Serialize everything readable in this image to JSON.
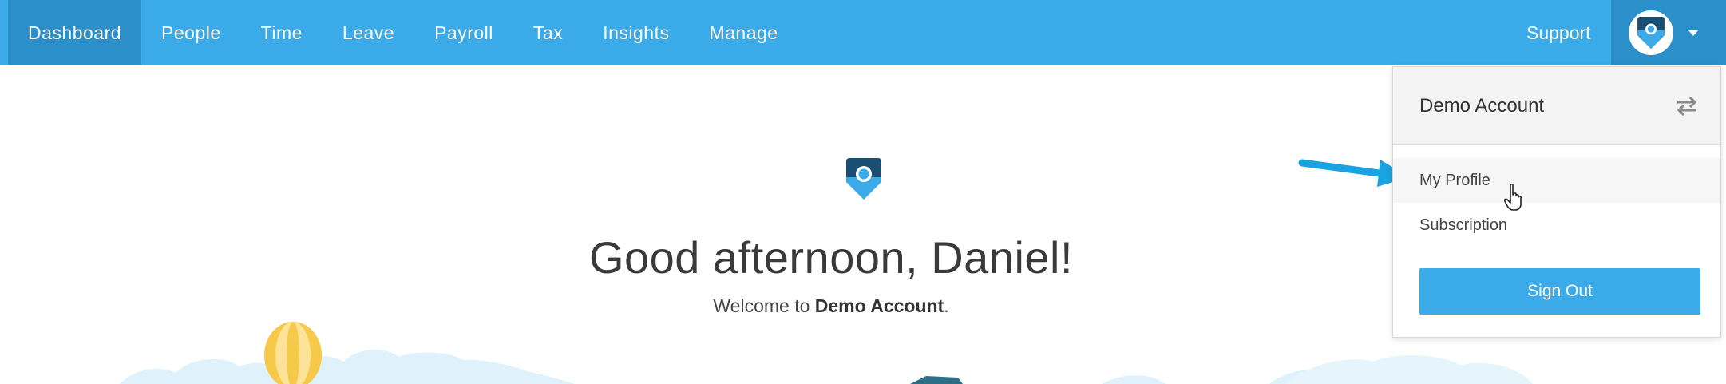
{
  "nav": {
    "items": [
      {
        "label": "Dashboard",
        "active": true
      },
      {
        "label": "People"
      },
      {
        "label": "Time"
      },
      {
        "label": "Leave"
      },
      {
        "label": "Payroll"
      },
      {
        "label": "Tax"
      },
      {
        "label": "Insights"
      },
      {
        "label": "Manage"
      }
    ],
    "support_label": "Support",
    "account_icon": "brand-logo-icon"
  },
  "main": {
    "greeting": "Good afternoon, Daniel!",
    "welcome_prefix": "Welcome to ",
    "welcome_account": "Demo Account",
    "welcome_suffix": "."
  },
  "dropdown": {
    "title": "Demo Account",
    "switch_icon": "swap-arrows-icon",
    "items": [
      {
        "label": "My Profile"
      },
      {
        "label": "Subscription"
      }
    ],
    "signout_label": "Sign Out"
  },
  "colors": {
    "nav_bg": "#3aabe8",
    "nav_active": "#2b8fca",
    "brand_dark": "#1a4f73",
    "button": "#3aabe8",
    "annotation_arrow": "#1aa3e0"
  }
}
